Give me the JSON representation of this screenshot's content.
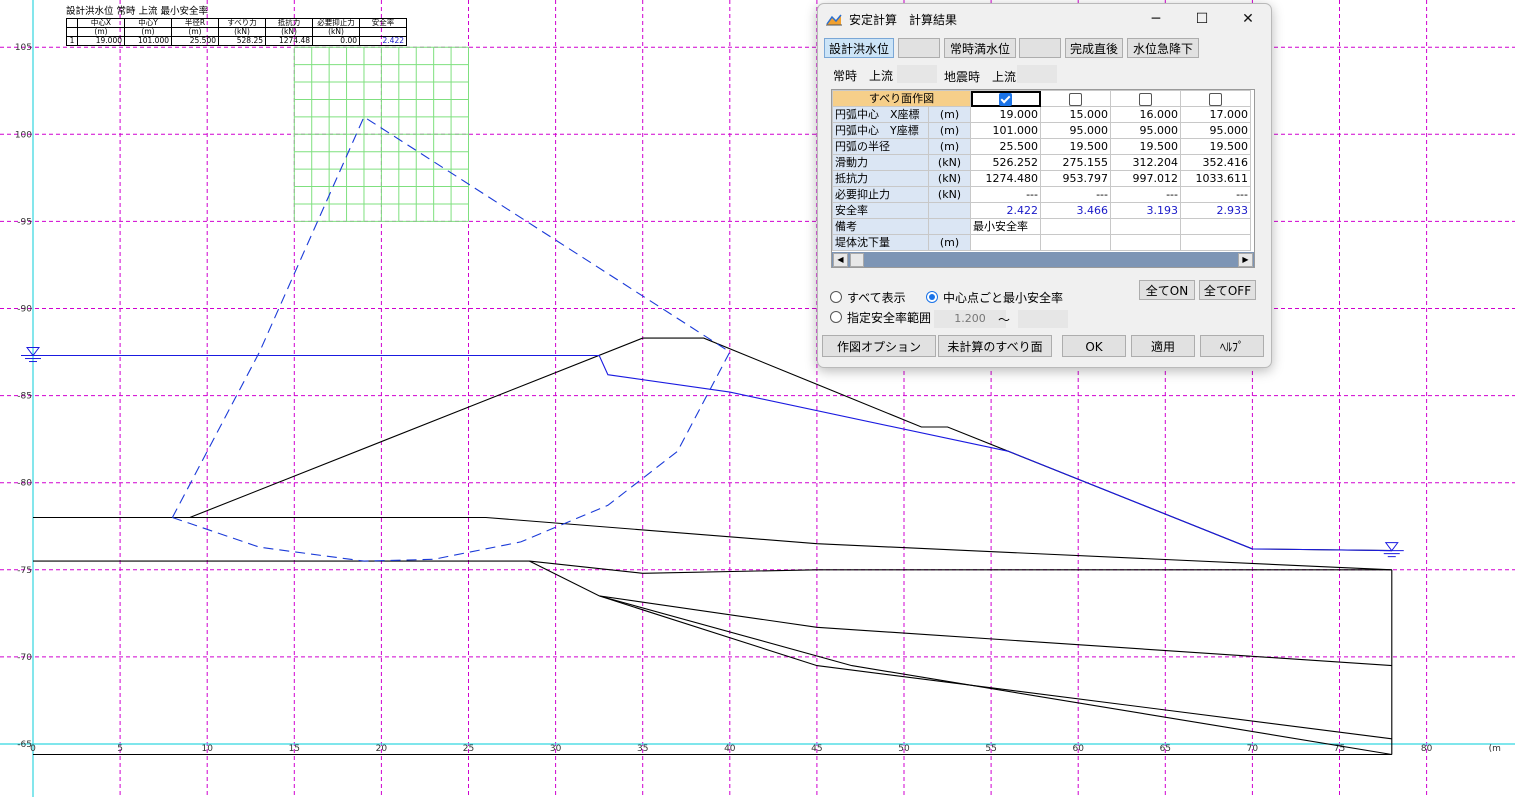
{
  "chart_data": {
    "type": "line",
    "xlim": [
      0,
      80
    ],
    "ylim": [
      64.5,
      107
    ],
    "x_ticks": [
      0,
      5,
      10,
      15,
      20,
      25,
      30,
      35,
      40,
      45,
      50,
      55,
      60,
      65,
      70,
      75,
      80
    ],
    "y_ticks": [
      65,
      70,
      75,
      80,
      85,
      90,
      95,
      100,
      105
    ],
    "x_tick_labels": [
      "0",
      "5",
      "10",
      "15",
      "20",
      "25",
      "30",
      "35",
      "40",
      "45",
      "50",
      "55",
      "60",
      "65",
      "70",
      "75",
      "80"
    ],
    "y_tick_labels": [
      "-65",
      "-70",
      "-75",
      "-80",
      "-85",
      "-90",
      "-95",
      "100",
      "105"
    ],
    "x_unit_label": "(m",
    "grid": true,
    "series": [
      {
        "kind": "ground",
        "points": [
          [
            0,
            78
          ],
          [
            26,
            78
          ],
          [
            45,
            76.5
          ],
          [
            78,
            75
          ]
        ]
      },
      {
        "kind": "ground",
        "points": [
          [
            0,
            75.5
          ],
          [
            28.5,
            75.5
          ],
          [
            35,
            74.8
          ],
          [
            45,
            75
          ],
          [
            78,
            75
          ]
        ]
      },
      {
        "kind": "ground",
        "points": [
          [
            28.5,
            75.5
          ],
          [
            32.5,
            73.5
          ],
          [
            45,
            71.7
          ],
          [
            78,
            69.5
          ]
        ]
      },
      {
        "kind": "ground",
        "points": [
          [
            32.5,
            73.5
          ],
          [
            45,
            69.5
          ],
          [
            78,
            65.3
          ]
        ]
      },
      {
        "kind": "ground",
        "points": [
          [
            32.5,
            73.5
          ],
          [
            47,
            69.5
          ],
          [
            78,
            64.4
          ]
        ]
      },
      {
        "kind": "ground",
        "points": [
          [
            9,
            78
          ],
          [
            35,
            88.3
          ],
          [
            38.5,
            88.3
          ],
          [
            51,
            83.2
          ],
          [
            52.5,
            83.2
          ],
          [
            70,
            76.2
          ],
          [
            78,
            76.1
          ]
        ]
      },
      {
        "kind": "ground",
        "points": [
          [
            78,
            75
          ],
          [
            78,
            64.4
          ]
        ]
      },
      {
        "kind": "ground",
        "points": [
          [
            0,
            64.4
          ],
          [
            78,
            64.4
          ]
        ]
      },
      {
        "kind": "water",
        "points": [
          [
            0,
            87.3
          ],
          [
            32.5,
            87.3
          ],
          [
            33,
            86.2
          ],
          [
            40,
            85.2
          ],
          [
            56,
            81.8
          ],
          [
            70,
            76.2
          ],
          [
            78,
            76.1
          ]
        ]
      },
      {
        "kind": "slip",
        "points": [
          [
            8,
            78
          ],
          [
            13,
            87.5
          ],
          [
            19,
            101
          ],
          [
            40,
            87.5
          ]
        ]
      },
      {
        "kind": "slip",
        "points": [
          [
            8,
            78
          ],
          [
            13,
            76.3
          ],
          [
            19,
            75.5
          ],
          [
            23,
            75.6
          ],
          [
            28,
            76.6
          ],
          [
            33,
            78.7
          ],
          [
            37,
            81.8
          ],
          [
            40,
            87.5
          ]
        ]
      }
    ],
    "water_level_markers": [
      [
        0,
        87.3
      ],
      [
        78,
        76.1
      ]
    ],
    "center_grid": {
      "x_range": [
        15,
        25
      ],
      "y_range": [
        95,
        105
      ],
      "step": 1
    },
    "summary_table": {
      "caption": "設計洪水位 常時 上流 最小安全率",
      "headers": [
        [
          "",
          "中心X",
          "中心Y",
          "半径R",
          "すべり力",
          "抵抗力",
          "必要抑止力",
          "安全率"
        ],
        [
          "",
          "(m)",
          "(m)",
          "(m)",
          "(kN)",
          "(kN)",
          "(kN)",
          ""
        ]
      ],
      "row": [
        "1",
        "19.000",
        "101.000",
        "25.500",
        "528.25",
        "1274.48",
        "0.00",
        "2.422"
      ]
    }
  },
  "dialog": {
    "title": "安定計算　計算結果",
    "window_buttons": [
      "─",
      "☐",
      "✕"
    ],
    "water_tabs": [
      "設計洪水位",
      "",
      "常時満水位",
      "",
      "完成直後",
      "水位急降下"
    ],
    "case_labels": [
      "常時　上流",
      "地震時　上流"
    ],
    "grid": {
      "header_label": "すべり面作図",
      "checks": [
        true,
        false,
        false,
        false
      ],
      "rows": [
        {
          "label": "円弧中心　X座標",
          "unit": "(m)",
          "values": [
            "19.000",
            "15.000",
            "16.000",
            "17.000"
          ]
        },
        {
          "label": "円弧中心　Y座標",
          "unit": "(m)",
          "values": [
            "101.000",
            "95.000",
            "95.000",
            "95.000"
          ]
        },
        {
          "label": "円弧の半径",
          "unit": "(m)",
          "values": [
            "25.500",
            "19.500",
            "19.500",
            "19.500"
          ]
        },
        {
          "label": "滑動力",
          "unit": "(kN)",
          "values": [
            "526.252",
            "275.155",
            "312.204",
            "352.416"
          ]
        },
        {
          "label": "抵抗力",
          "unit": "(kN)",
          "values": [
            "1274.480",
            "953.797",
            "997.012",
            "1033.611"
          ]
        },
        {
          "label": "必要抑止力",
          "unit": "(kN)",
          "values": [
            "---",
            "---",
            "---",
            "---"
          ]
        },
        {
          "label": "安全率",
          "unit": "",
          "values": [
            "2.422",
            "3.466",
            "3.193",
            "2.933"
          ]
        },
        {
          "label": "備考",
          "unit": "",
          "values": [
            "最小安全率",
            "",
            "",
            ""
          ]
        },
        {
          "label": "堤体沈下量",
          "unit": "(m)",
          "values": [
            "",
            "",
            "",
            ""
          ]
        }
      ]
    },
    "all_on": "全てON",
    "all_off": "全てOFF",
    "radio_all": "すべて表示",
    "radio_min": "中心点ごと最小安全率",
    "radio_range": "指定安全率範囲",
    "range_from": "1.200",
    "range_tilde": "〜",
    "buttons": {
      "plot_option": "作図オプション",
      "uncalc": "未計算のすべり面",
      "ok": "OK",
      "apply": "適用",
      "help": "ﾍﾙﾌﾟ"
    }
  }
}
